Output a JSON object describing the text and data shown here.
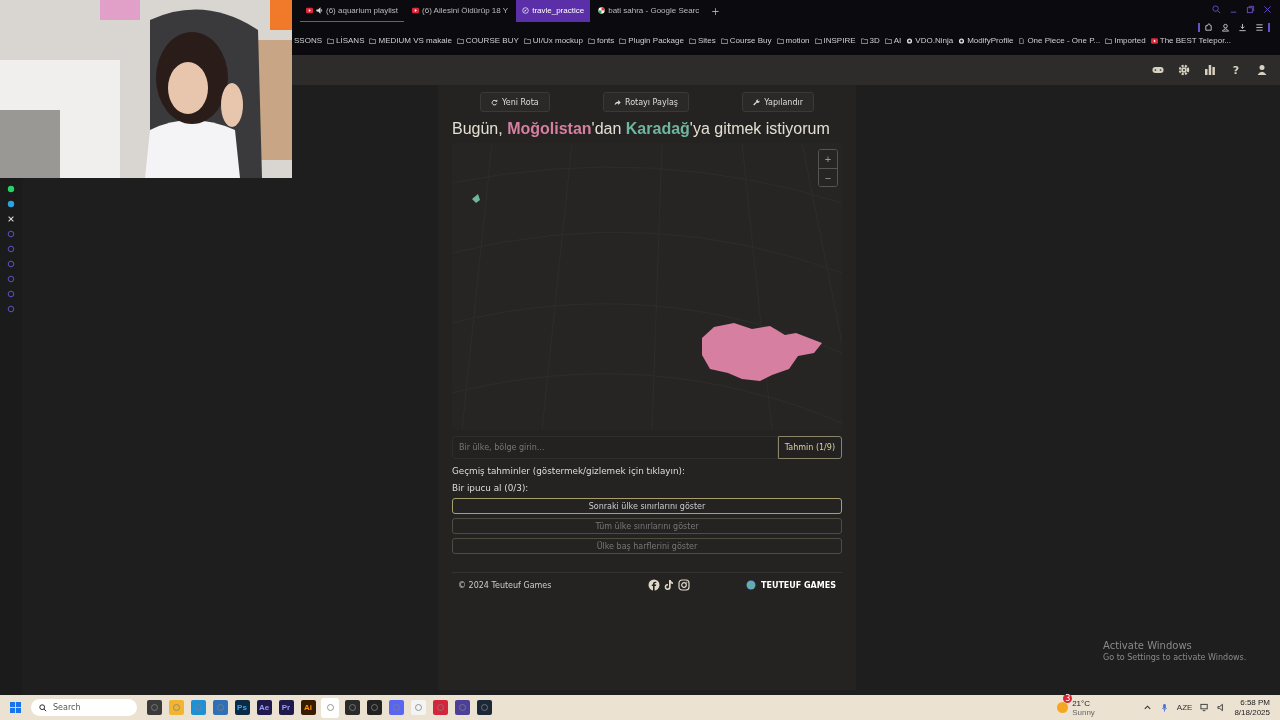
{
  "browser": {
    "tabs": [
      {
        "title": "(6) aquarium playlist",
        "kind": "video",
        "audio": true,
        "selected": false
      },
      {
        "title": "(6) Ailesini Öldürüp 18 Y",
        "kind": "video",
        "audio": false,
        "selected": false
      },
      {
        "title": "travle_practice",
        "kind": "compass",
        "audio": false,
        "selected": true
      },
      {
        "title": "bati sahra - Google Searc",
        "kind": "search",
        "audio": false,
        "selected": false
      }
    ],
    "new_tab": "+",
    "bookmarks": [
      {
        "label": "SSONS",
        "kind": "text"
      },
      {
        "label": "LİSANS",
        "kind": "folder"
      },
      {
        "label": "MEDIUM VS makale",
        "kind": "folder"
      },
      {
        "label": "COURSE BUY",
        "kind": "folder"
      },
      {
        "label": "UI/Ux mockup",
        "kind": "folder"
      },
      {
        "label": "fonts",
        "kind": "folder"
      },
      {
        "label": "Plugin Package",
        "kind": "folder"
      },
      {
        "label": "Sites",
        "kind": "folder"
      },
      {
        "label": "Course Buy",
        "kind": "folder"
      },
      {
        "label": "motion",
        "kind": "folder"
      },
      {
        "label": "INSPIRE",
        "kind": "folder"
      },
      {
        "label": "3D",
        "kind": "folder"
      },
      {
        "label": "AI",
        "kind": "folder"
      },
      {
        "label": "VDO.Ninja",
        "kind": "site"
      },
      {
        "label": "ModifyProfile",
        "kind": "site"
      },
      {
        "label": "One Piece - One P...",
        "kind": "page"
      },
      {
        "label": "Imported",
        "kind": "folder"
      },
      {
        "label": "The BEST Telepor...",
        "kind": "video"
      }
    ]
  },
  "app": {
    "help": "?",
    "actions": [
      {
        "label": "Yeni Rota",
        "kind": "refresh"
      },
      {
        "label": "Rotayı Paylaş",
        "kind": "share"
      },
      {
        "label": "Yapılandır",
        "kind": "wrench"
      }
    ],
    "title": [
      {
        "text": "Bugün, ",
        "kind": "plain"
      },
      {
        "text": "Moğolistan",
        "kind": "start"
      },
      {
        "text": "'dan ",
        "kind": "plain"
      },
      {
        "text": "Karadağ",
        "kind": "end"
      },
      {
        "text": "'ya gitmek istiyorum",
        "kind": "plain"
      }
    ],
    "map": {
      "zoom_in": "+",
      "zoom_out": "−"
    },
    "guess": {
      "placeholder": "Bir ülke, bölge girin...",
      "button": "Tahmin (1/9)"
    },
    "history_label": "Geçmiş tahminler (göstermek/gizlemek için tıklayın):",
    "hint_label": "Bir ipucu al (0/3):",
    "hints": [
      {
        "label": "Sonraki ülke sınırlarını göster",
        "disabled": false
      },
      {
        "label": "Tüm ülke sınırlarını göster",
        "disabled": true
      },
      {
        "label": "Ülke baş harflerini göster",
        "disabled": true
      }
    ],
    "footer": {
      "copyright": "© 2024 Teuteuf Games",
      "brand": "TEUTEUF GAMES"
    }
  },
  "activation": {
    "title": "Activate Windows",
    "subtitle": "Go to Settings to activate Windows."
  },
  "taskbar": {
    "search": {
      "placeholder": "Search"
    },
    "apps": [
      {
        "kind": "tile",
        "selected": false
      },
      {
        "kind": "folder",
        "selected": false
      },
      {
        "kind": "edge",
        "selected": false
      },
      {
        "kind": "store",
        "selected": false
      },
      {
        "kind": "ps",
        "label": "Ps",
        "selected": false
      },
      {
        "kind": "ae",
        "label": "Ae",
        "selected": false
      },
      {
        "kind": "pr",
        "label": "Pr",
        "selected": false
      },
      {
        "kind": "ai",
        "label": "Ai",
        "selected": false
      },
      {
        "kind": "opera",
        "selected": true
      },
      {
        "kind": "hex",
        "selected": false
      },
      {
        "kind": "record",
        "selected": false
      },
      {
        "kind": "chat",
        "selected": false
      },
      {
        "kind": "cut",
        "selected": false
      },
      {
        "kind": "red",
        "selected": false
      },
      {
        "kind": "shield",
        "selected": false
      },
      {
        "kind": "steam",
        "selected": false
      }
    ],
    "weather": {
      "badge": "3",
      "temp": "21°C",
      "condition": "Sunny"
    },
    "language": "AZE",
    "clock": {
      "time": "6:58 PM",
      "date": "8/18/2025"
    }
  }
}
